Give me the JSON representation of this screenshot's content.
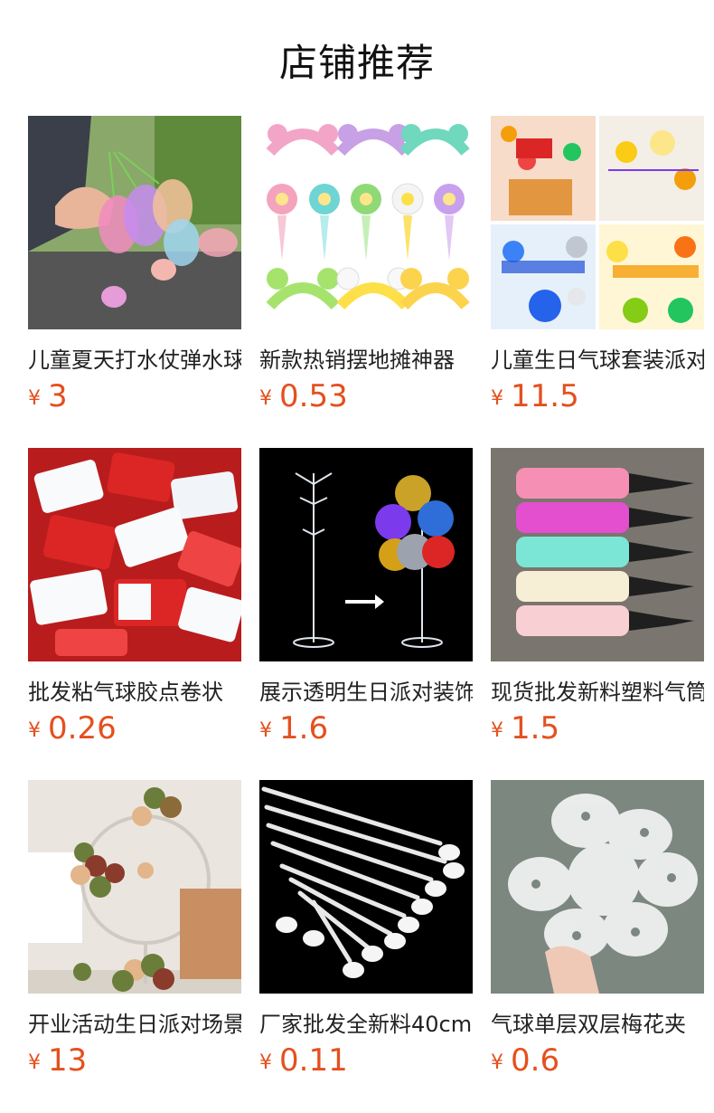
{
  "page": {
    "title": "店铺推荐",
    "currency": "¥"
  },
  "products": [
    {
      "name": "儿童夏天打水仗弹水球",
      "price": "3",
      "image": "water-balloons-image"
    },
    {
      "name": "新款热销摆地摊神器",
      "price": "0.53",
      "image": "flower-balloon-headbands-image"
    },
    {
      "name": "儿童生日气球套装派对",
      "price": "11.5",
      "image": "birthday-party-collage-image"
    },
    {
      "name": "批发粘气球胶点卷状",
      "price": "0.26",
      "image": "balloon-glue-packets-image"
    },
    {
      "name": "展示透明生日派对装饰",
      "price": "1.6",
      "image": "balloon-stand-image"
    },
    {
      "name": "现货批发新料塑料气筒",
      "price": "1.5",
      "image": "hand-pumps-image"
    },
    {
      "name": "开业活动生日派对场景",
      "price": "13",
      "image": "balloon-arch-image"
    },
    {
      "name": "厂家批发全新料40cm",
      "price": "0.11",
      "image": "balloon-sticks-image"
    },
    {
      "name": "气球单层双层梅花夹",
      "price": "0.6",
      "image": "flower-clip-image"
    }
  ]
}
